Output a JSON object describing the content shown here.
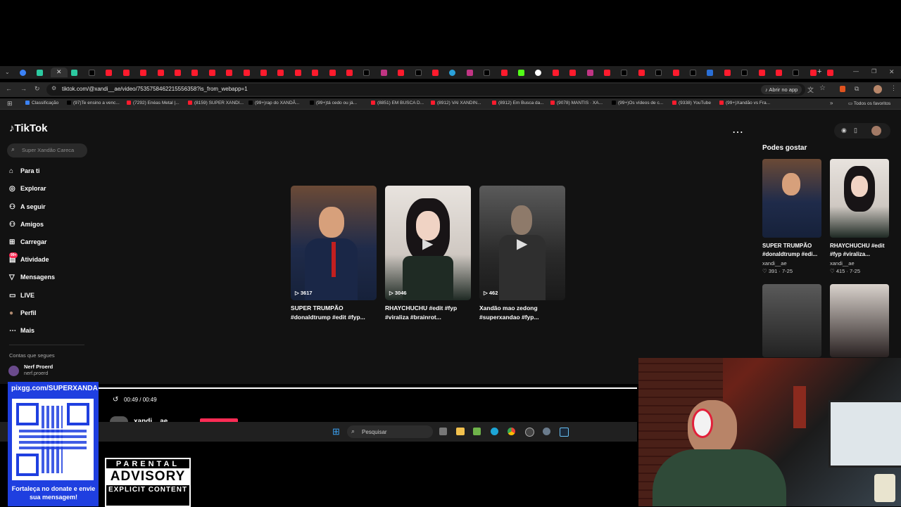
{
  "browser": {
    "url": "tiktok.com/@xandi__ae/video/7535758462215556358?is_from_webapp=1",
    "open_in_app": "Abrir no app",
    "bookmarks": [
      "Classificação",
      "(97)Te ensino a venc...",
      "(7292) Enéas Metal |...",
      "(8159) SUPER XANDI...",
      "(99+)rap do XANDÃ...",
      "(99+)tá cedo ou já...",
      "(8851) EM BUSCA D...",
      "(8912) VAI XANDIN...",
      "(8912) Em Busca da...",
      "(9078) MANTIS · XA...",
      "(99+)Os vídeos de c...",
      "(9338) YouTube",
      "(99+)Xandão vs Fra..."
    ],
    "all_favorites": "Todos os favoritos"
  },
  "tiktok": {
    "logo": "TikTok",
    "search_placeholder": "Super Xandão Careca",
    "nav": [
      {
        "label": "Para ti",
        "icon": "home-icon"
      },
      {
        "label": "Explorar",
        "icon": "compass-icon"
      },
      {
        "label": "A seguir",
        "icon": "following-icon"
      },
      {
        "label": "Amigos",
        "icon": "friends-icon"
      },
      {
        "label": "Carregar",
        "icon": "upload-icon"
      },
      {
        "label": "Atividade",
        "icon": "activity-icon"
      },
      {
        "label": "Mensagens",
        "icon": "messages-icon"
      },
      {
        "label": "LIVE",
        "icon": "live-icon"
      },
      {
        "label": "Perfil",
        "icon": "profile-icon"
      },
      {
        "label": "Mais",
        "icon": "more-icon"
      }
    ],
    "activity_badge": "99+",
    "following_heading": "Contas que segues",
    "following_account": {
      "name": "Nerf Proerd",
      "handle": "nerf.proerd"
    },
    "videos": [
      {
        "title": "SUPER TRUMPÃO #donaldtrump #edit #fyp...",
        "views": "3617"
      },
      {
        "title": "RHAYCHUCHU #edit #fyp #viraliza #brainrot...",
        "views": "3046"
      },
      {
        "title": "Xandão mao zedong #superxandao #fyp...",
        "views": "462"
      }
    ],
    "suggestions_heading": "Podes gostar",
    "suggestions": [
      {
        "title": "SUPER TRUMPÃO #donaldtrump #edi...",
        "author": "xandi__ae",
        "likes": "391",
        "date": "7-25"
      },
      {
        "title": "RHAYCHUCHU #edit #fyp #viraliza...",
        "author": "xandi__ae",
        "likes": "415",
        "date": "7-25"
      }
    ],
    "time": "00:49 / 00:49",
    "author_partial": "xandi__ae"
  },
  "taskbar": {
    "search_placeholder": "Pesquisar"
  },
  "overlay": {
    "donate_url": "pixgg.com/SUPERXANDA",
    "donate_message": "Fortaleça no donate e envie sua mensagem!",
    "parental_advisory": {
      "line1": "PARENTAL",
      "line2": "ADVISORY",
      "line3": "EXPLICIT CONTENT"
    }
  },
  "colors": {
    "accent": "#fe2c55",
    "page_bg": "#121212",
    "qr_bg": "#1f3fe0"
  }
}
